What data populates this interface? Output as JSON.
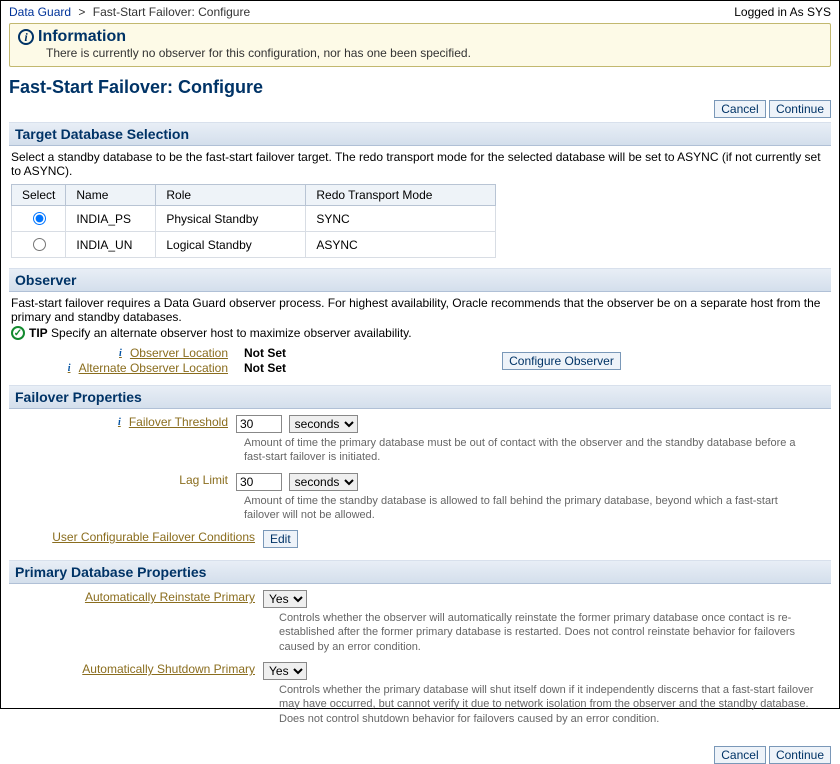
{
  "breadcrumb": {
    "root": "Data Guard",
    "current": "Fast-Start Failover: Configure"
  },
  "login_text": "Logged in As SYS",
  "info": {
    "title": "Information",
    "message": "There is currently no observer for this configuration, nor has one been specified."
  },
  "page_title": "Fast-Start Failover: Configure",
  "buttons": {
    "cancel": "Cancel",
    "continue": "Continue",
    "configure_observer": "Configure Observer",
    "edit": "Edit"
  },
  "target_db": {
    "header": "Target Database Selection",
    "blurb": "Select a standby database to be the fast-start failover target. The redo transport mode for the selected database will be set to ASYNC (if not currently set to ASYNC).",
    "cols": {
      "select": "Select",
      "name": "Name",
      "role": "Role",
      "mode": "Redo Transport Mode"
    },
    "rows": [
      {
        "name": "INDIA_PS",
        "role": "Physical Standby",
        "mode": "SYNC",
        "selected": true
      },
      {
        "name": "INDIA_UN",
        "role": "Logical Standby",
        "mode": "ASYNC",
        "selected": false
      }
    ]
  },
  "observer": {
    "header": "Observer",
    "blurb": "Fast-start failover requires a Data Guard observer process. For highest availability, Oracle recommends that the observer be on a separate host from the primary and standby databases.",
    "tip_label": "TIP",
    "tip_text": "Specify an alternate observer host to maximize observer availability.",
    "loc_label": "Observer Location",
    "alt_label": "Alternate Observer Location",
    "loc_value": "Not Set",
    "alt_value": "Not Set"
  },
  "failover": {
    "header": "Failover Properties",
    "threshold_label": "Failover Threshold",
    "threshold_value": "30",
    "threshold_unit": "seconds",
    "threshold_hint": "Amount of time the primary database must be out of contact with the observer and the standby database before a fast-start failover is initiated.",
    "lag_label": "Lag Limit",
    "lag_value": "30",
    "lag_unit": "seconds",
    "lag_hint": "Amount of time the standby database is allowed to fall behind the primary database, beyond which a fast-start failover will not be allowed.",
    "conditions_label": "User Configurable Failover Conditions"
  },
  "primary": {
    "header": "Primary Database Properties",
    "reinstate_label": "Automatically Reinstate Primary",
    "reinstate_value": "Yes",
    "reinstate_hint": "Controls whether the observer will automatically reinstate the former primary database once contact is re-established after the former primary database is restarted. Does not control reinstate behavior for failovers caused by an error condition.",
    "shutdown_label": "Automatically Shutdown Primary",
    "shutdown_value": "Yes",
    "shutdown_hint": "Controls whether the primary database will shut itself down if it independently discerns that a fast-start failover may have occurred, but cannot verify it due to network isolation from the observer and the standby database. Does not control shutdown behavior for failovers caused by an error condition."
  }
}
